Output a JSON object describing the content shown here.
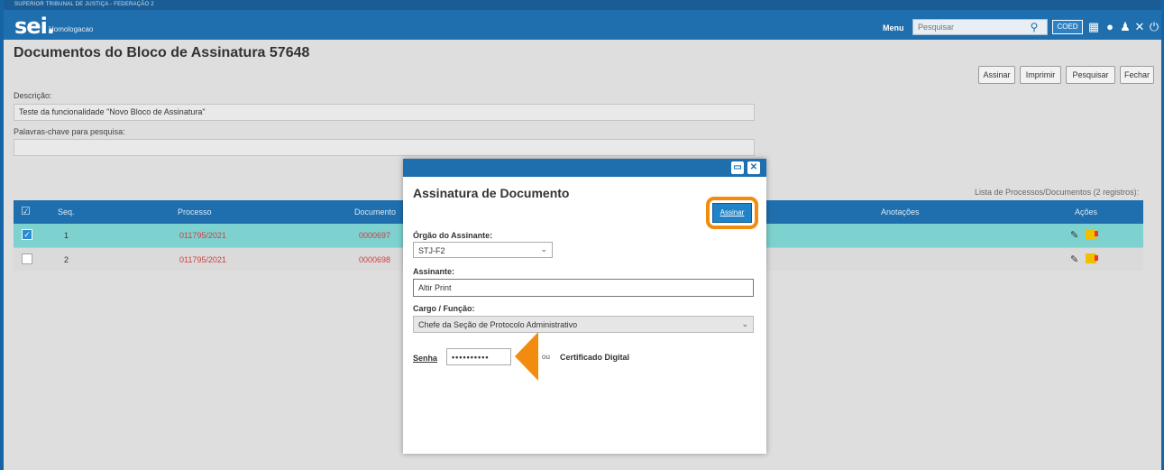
{
  "app": {
    "top_strip": "SUPERIOR TRIBUNAL DE JUSTIÇA - FEDERAÇÃO 2",
    "logo": "sei.",
    "environment": "Homologacao",
    "menu_label": "Menu",
    "search_placeholder": "Pesquisar",
    "unit_badge": "COED"
  },
  "page": {
    "title": "Documentos do Bloco de Assinatura 57648",
    "toolbar": [
      "Assinar",
      "Imprimir",
      "Pesquisar",
      "Fechar"
    ],
    "descricao_label": "Descrição:",
    "descricao_value": "Teste da funcionalidade \"Novo Bloco de Assinatura\"",
    "palavras_label": "Palavras-chave para pesquisa:",
    "palavras_value": "",
    "list_caption": "Lista de Processos/Documentos (2 registros):"
  },
  "table": {
    "headers": {
      "check": "☑",
      "seq": "Seq.",
      "processo": "Processo",
      "documento": "Documento",
      "anotacoes": "Anotações",
      "acoes": "Ações"
    },
    "rows": [
      {
        "seq": "1",
        "processo": "011795/2021",
        "documento": "0000697",
        "checked": true
      },
      {
        "seq": "2",
        "processo": "011795/2021",
        "documento": "0000698",
        "checked": false
      }
    ]
  },
  "modal": {
    "title": "Assinatura de Documento",
    "assinar_button": "Assinar",
    "orgao_label": "Órgão do Assinante:",
    "orgao_value": "STJ-F2",
    "assinante_label": "Assinante:",
    "assinante_value": "Altir Print",
    "cargo_label": "Cargo / Função:",
    "cargo_value": "Chefe da Seção de Protocolo Administrativo",
    "senha_label": "Senha",
    "senha_value": "••••••••••",
    "ou_text": "ou",
    "cert_label": "Certificado Digital"
  },
  "colors": {
    "header": "#1f6fae",
    "row_selected": "#7dd1ce",
    "highlight": "#f28c0f"
  }
}
